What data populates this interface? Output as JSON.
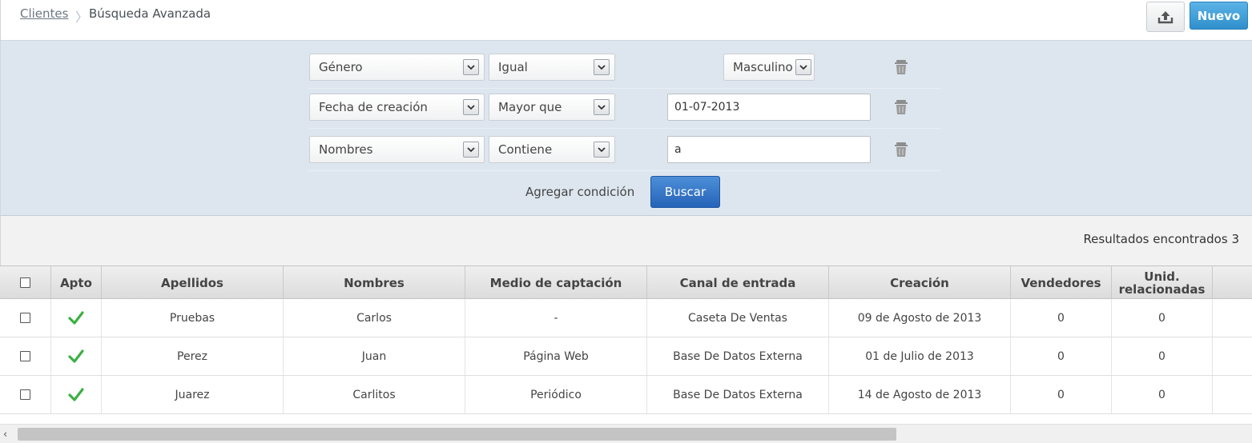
{
  "breadcrumb": {
    "parent": "Clientes",
    "separator": "〉",
    "current": "Búsqueda Avanzada"
  },
  "header": {
    "new_button": "Nuevo",
    "upload_icon": "upload-icon"
  },
  "filters": {
    "rows": [
      {
        "field": "Género",
        "operator": "Igual",
        "value": "Masculino",
        "value_type": "select"
      },
      {
        "field": "Fecha de creación",
        "operator": "Mayor que",
        "value": "01-07-2013",
        "value_type": "text"
      },
      {
        "field": "Nombres",
        "operator": "Contiene",
        "value": "a",
        "value_type": "text"
      }
    ],
    "add_condition": "Agregar condición",
    "search_button": "Buscar"
  },
  "results": {
    "label": "Resultados encontrados 3"
  },
  "table": {
    "columns": [
      "Apto",
      "Apellidos",
      "Nombres",
      "Medio de captación",
      "Canal de entrada",
      "Creación",
      "Vendedores",
      "Unid. relacionadas"
    ],
    "rows": [
      {
        "apto": "✔",
        "apellidos": "Pruebas",
        "nombres": "Carlos",
        "medio": "-",
        "canal": "Caseta De Ventas",
        "creacion": "09 de Agosto de 2013",
        "vendedores": "0",
        "unidades": "0"
      },
      {
        "apto": "✔",
        "apellidos": "Perez",
        "nombres": "Juan",
        "medio": "Página Web",
        "canal": "Base De Datos Externa",
        "creacion": "01 de Julio de 2013",
        "vendedores": "0",
        "unidades": "0"
      },
      {
        "apto": "✔",
        "apellidos": "Juarez",
        "nombres": "Carlitos",
        "medio": "Periódico",
        "canal": "Base De Datos Externa",
        "creacion": "14 de Agosto de 2013",
        "vendedores": "0",
        "unidades": "0"
      }
    ]
  },
  "colors": {
    "accent_blue": "#2f8fcc",
    "search_blue": "#2563b8",
    "check_green": "#3cb043",
    "filter_bg": "#dde6ef"
  },
  "scrollbar": {
    "left_arrow": "‹"
  }
}
